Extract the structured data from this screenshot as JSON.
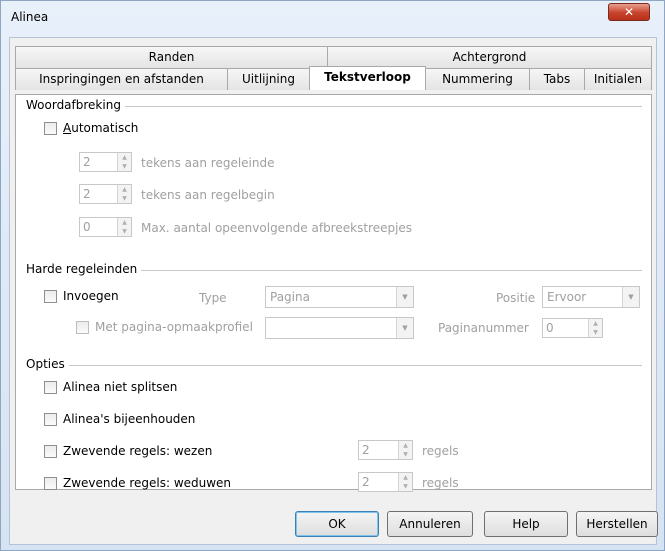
{
  "window": {
    "title": "Alinea",
    "close_glyph": "✕"
  },
  "tabs_row1": [
    "Randen",
    "Achtergrond"
  ],
  "tabs_row2": [
    "Inspringingen en afstanden",
    "Uitlijning",
    "Tekstverloop",
    "Nummering",
    "Tabs",
    "Initialen"
  ],
  "active_tab": "Tekstverloop",
  "hyphenation": {
    "group": "Woordafbreking",
    "automatic": "Automatisch",
    "end_chars_value": "2",
    "end_chars_label": "tekens aan regeleinde",
    "begin_chars_value": "2",
    "begin_chars_label": "tekens aan regelbegin",
    "max_value": "0",
    "max_label": "Max. aantal opeenvolgende afbreekstreepjes"
  },
  "breaks": {
    "group": "Harde regeleinden",
    "insert": "Invoegen",
    "type_label": "Type",
    "type_value": "Pagina",
    "position_label": "Positie",
    "position_value": "Ervoor",
    "with_style": "Met pagina-opmaakprofiel",
    "style_value": "",
    "page_number_label": "Paginanummer",
    "page_number_value": "0"
  },
  "options": {
    "group": "Opties",
    "dont_split": "Alinea niet splitsen",
    "keep_together": "Alinea's bijeenhouden",
    "orphans": "Zwevende regels: wezen",
    "orphans_value": "2",
    "orphans_unit": "regels",
    "widows": "Zwevende regels: weduwen",
    "widows_value": "2",
    "widows_unit": "regels"
  },
  "buttons": {
    "ok": "OK",
    "cancel": "Annuleren",
    "help": "Help",
    "reset": "Herstellen"
  },
  "icons": {
    "spin_up": "▲",
    "spin_down": "▼",
    "drop": "▼"
  }
}
